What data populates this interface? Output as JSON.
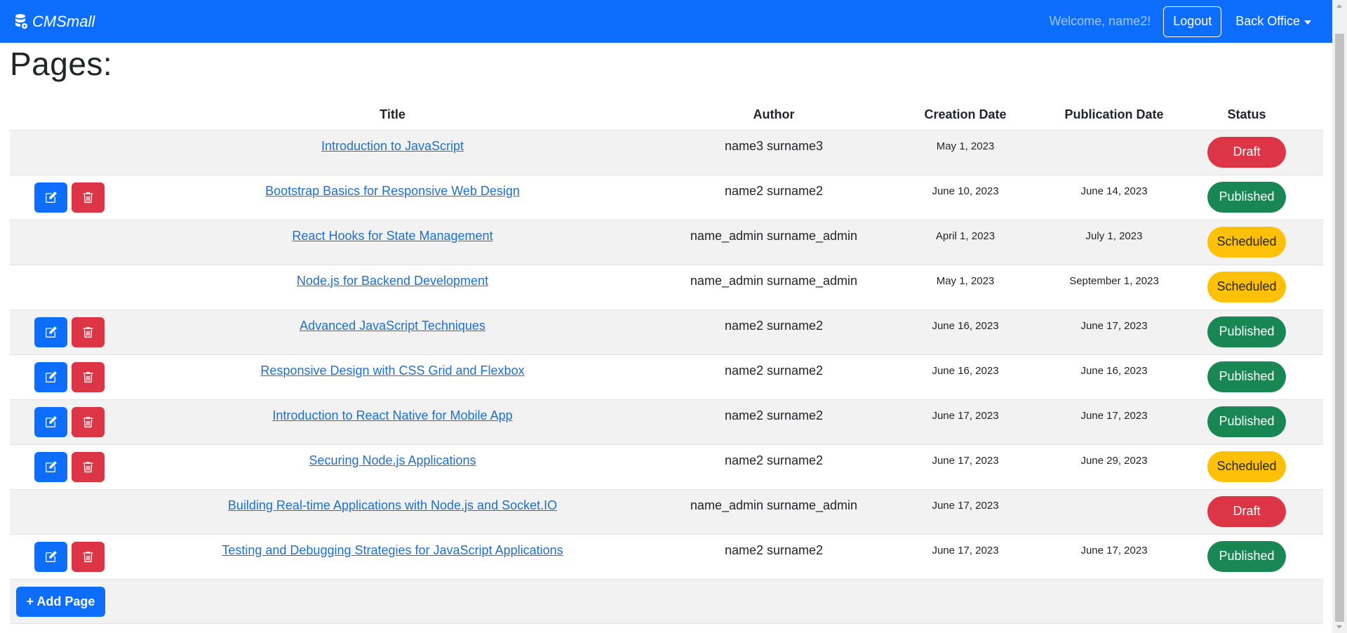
{
  "navbar": {
    "brand": "CMSmall",
    "welcome": "Welcome, name2!",
    "logout_label": "Logout",
    "backoffice_label": "Back Office"
  },
  "page_title": "Pages:",
  "table": {
    "headers": {
      "title": "Title",
      "author": "Author",
      "creation_date": "Creation Date",
      "publication_date": "Publication Date",
      "status": "Status"
    },
    "rows": [
      {
        "title": "Introduction to JavaScript",
        "author": "name3 surname3",
        "created": "May 1, 2023",
        "published": "",
        "status": "Draft",
        "editable": false
      },
      {
        "title": "Bootstrap Basics for Responsive Web Design",
        "author": "name2 surname2",
        "created": "June 10, 2023",
        "published": "June 14, 2023",
        "status": "Published",
        "editable": true
      },
      {
        "title": "React Hooks for State Management",
        "author": "name_admin surname_admin",
        "created": "April 1, 2023",
        "published": "July 1, 2023",
        "status": "Scheduled",
        "editable": false
      },
      {
        "title": "Node.js for Backend Development",
        "author": "name_admin surname_admin",
        "created": "May 1, 2023",
        "published": "September 1, 2023",
        "status": "Scheduled",
        "editable": false
      },
      {
        "title": "Advanced JavaScript Techniques",
        "author": "name2 surname2",
        "created": "June 16, 2023",
        "published": "June 17, 2023",
        "status": "Published",
        "editable": true
      },
      {
        "title": "Responsive Design with CSS Grid and Flexbox",
        "author": "name2 surname2",
        "created": "June 16, 2023",
        "published": "June 16, 2023",
        "status": "Published",
        "editable": true
      },
      {
        "title": "Introduction to React Native for Mobile App",
        "author": "name2 surname2",
        "created": "June 17, 2023",
        "published": "June 17, 2023",
        "status": "Published",
        "editable": true
      },
      {
        "title": "Securing Node.js Applications",
        "author": "name2 surname2",
        "created": "June 17, 2023",
        "published": "June 29, 2023",
        "status": "Scheduled",
        "editable": true
      },
      {
        "title": "Building Real-time Applications with Node.js and Socket.IO",
        "author": "name_admin surname_admin",
        "created": "June 17, 2023",
        "published": "",
        "status": "Draft",
        "editable": false
      },
      {
        "title": "Testing and Debugging Strategies for JavaScript Applications",
        "author": "name2 surname2",
        "created": "June 17, 2023",
        "published": "June 17, 2023",
        "status": "Published",
        "editable": true
      }
    ]
  },
  "add_page_label": "+ Add Page",
  "colors": {
    "primary": "#0d6efd",
    "danger": "#dc3545",
    "success": "#198754",
    "warning": "#ffc107"
  },
  "icons": {
    "brand": "database-gear-icon",
    "edit": "pencil-square-icon",
    "delete": "trash-icon"
  }
}
